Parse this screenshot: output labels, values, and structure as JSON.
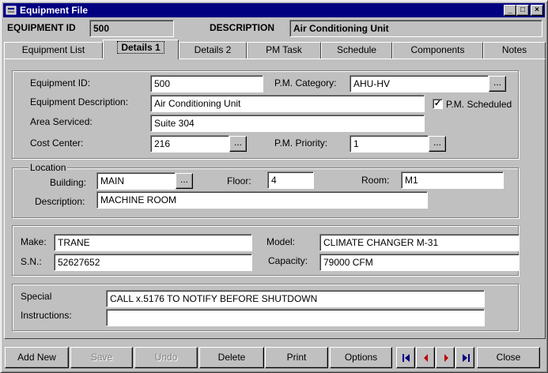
{
  "window": {
    "title": "Equipment File",
    "minimize_glyph": "_",
    "maximize_glyph": "□",
    "close_glyph": "×"
  },
  "header": {
    "equipment_id_label": "EQUIPMENT ID",
    "equipment_id_value": "500",
    "description_label": "DESCRIPTION",
    "description_value": "Air Conditioning Unit"
  },
  "tabs": [
    {
      "label": "Equipment List"
    },
    {
      "label": "Details 1"
    },
    {
      "label": "Details 2"
    },
    {
      "label": "PM Task"
    },
    {
      "label": "Schedule"
    },
    {
      "label": "Components"
    },
    {
      "label": "Notes"
    }
  ],
  "active_tab": "Details 1",
  "details": {
    "equipment_id_label": "Equipment ID:",
    "equipment_id_value": "500",
    "pm_category_label": "P.M. Category:",
    "pm_category_value": "AHU-HV",
    "description_label": "Equipment Description:",
    "description_value": "Air Conditioning Unit",
    "pm_scheduled_label": "P.M. Scheduled",
    "pm_scheduled_checked": true,
    "area_label": "Area Serviced:",
    "area_value": "Suite 304",
    "cost_center_label": "Cost Center:",
    "cost_center_value": "216",
    "pm_priority_label": "P.M. Priority:",
    "pm_priority_value": "1",
    "ellipsis": "..."
  },
  "location": {
    "title": "Location",
    "building_label": "Building:",
    "building_value": "MAIN",
    "floor_label": "Floor:",
    "floor_value": "4",
    "room_label": "Room:",
    "room_value": "M1",
    "description_label": "Description:",
    "description_value": "MACHINE ROOM"
  },
  "specs": {
    "make_label": "Make:",
    "make_value": "TRANE",
    "model_label": "Model:",
    "model_value": "CLIMATE CHANGER M-31",
    "sn_label": "S.N.:",
    "sn_value": "52627652",
    "capacity_label": "Capacity:",
    "capacity_value": "79000 CFM"
  },
  "special": {
    "special_label": "Special",
    "instructions_label": "Instructions:",
    "line1": "CALL x.5176 TO NOTIFY BEFORE SHUTDOWN",
    "line2": ""
  },
  "buttons": {
    "add_new": "Add New",
    "save": "Save",
    "undo": "Undo",
    "delete": "Delete",
    "print": "Print",
    "options": "Options",
    "close": "Close"
  },
  "colors": {
    "title_bar": "#000080",
    "face": "#c0c0c0",
    "nav_arrow_first_last": "#000080",
    "nav_arrow_prev_next": "#c00000"
  }
}
